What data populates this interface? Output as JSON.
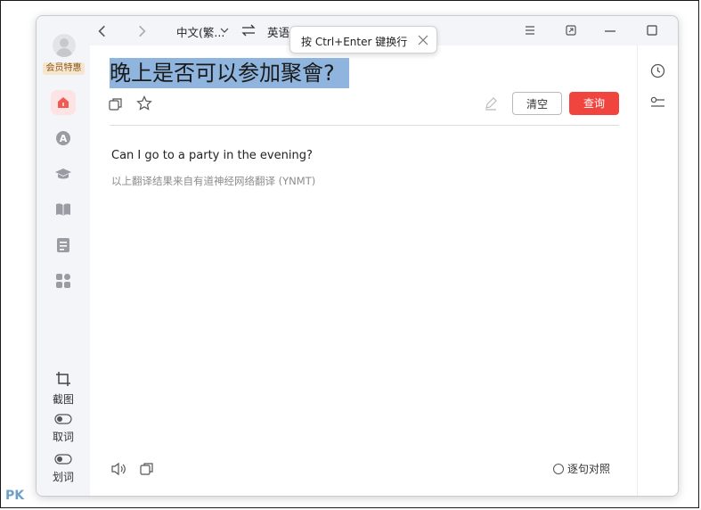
{
  "user": {
    "vip_badge": "会员特惠"
  },
  "titlebar": {
    "source_lang": "中文(繁...",
    "target_lang": "英语",
    "tooltip": "按 Ctrl+Enter 键换行"
  },
  "input": {
    "text": "晚上是否可以参加聚會?"
  },
  "buttons": {
    "clear": "清空",
    "query": "查询"
  },
  "result": {
    "translation": "Can I go to a party in the evening?",
    "source": "以上翻译结果来自有道神经网络翻译 (YNMT)"
  },
  "sidebar_tools": {
    "screenshot": "截图",
    "pick_word": "取词",
    "select_word": "划词"
  },
  "bottom": {
    "compare_label": "逐句对照"
  },
  "watermark": "PK",
  "colors": {
    "accent": "#f0453f",
    "highlight": "#8fb5de"
  }
}
